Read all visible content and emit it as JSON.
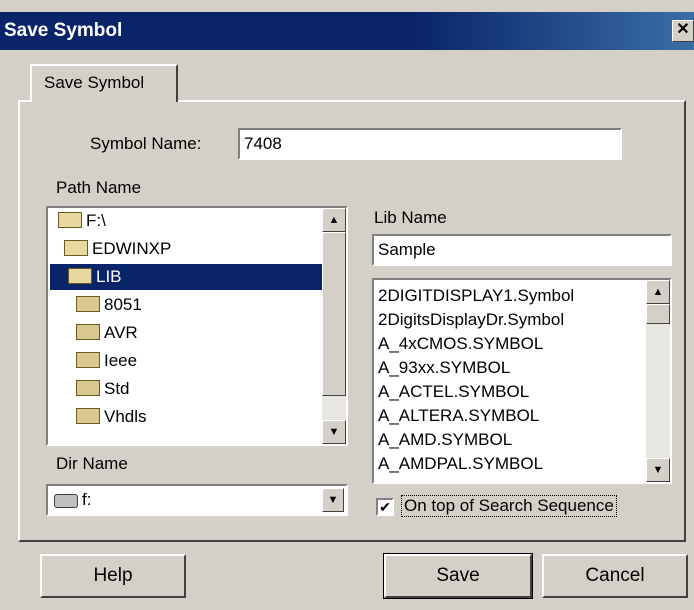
{
  "window": {
    "title": "Save Symbol",
    "close_label": "✕"
  },
  "tab": {
    "label": "Save Symbol"
  },
  "symbol_name": {
    "label": "Symbol Name:",
    "value": "7408"
  },
  "path_name": {
    "label": "Path Name",
    "items": [
      "F:\\",
      "EDWINXP",
      "LIB",
      "8051",
      "AVR",
      "Ieee",
      "Std",
      "Vhdls"
    ]
  },
  "dir_name": {
    "label": "Dir Name",
    "value": "f:"
  },
  "lib_name": {
    "label": "Lib Name",
    "value": "Sample",
    "items": [
      "2DIGITDISPLAY1.Symbol",
      "2DigitsDisplayDr.Symbol",
      "A_4xCMOS.SYMBOL",
      "A_93xx.SYMBOL",
      "A_ACTEL.SYMBOL",
      "A_ALTERA.SYMBOL",
      "A_AMD.SYMBOL",
      "A_AMDPAL.SYMBOL"
    ]
  },
  "search_option": {
    "label": "On top of Search Sequence",
    "checked": true,
    "check_mark": "✔"
  },
  "buttons": {
    "help": "Help",
    "save": "Save",
    "cancel": "Cancel"
  },
  "glyphs": {
    "up": "▲",
    "down": "▼"
  }
}
